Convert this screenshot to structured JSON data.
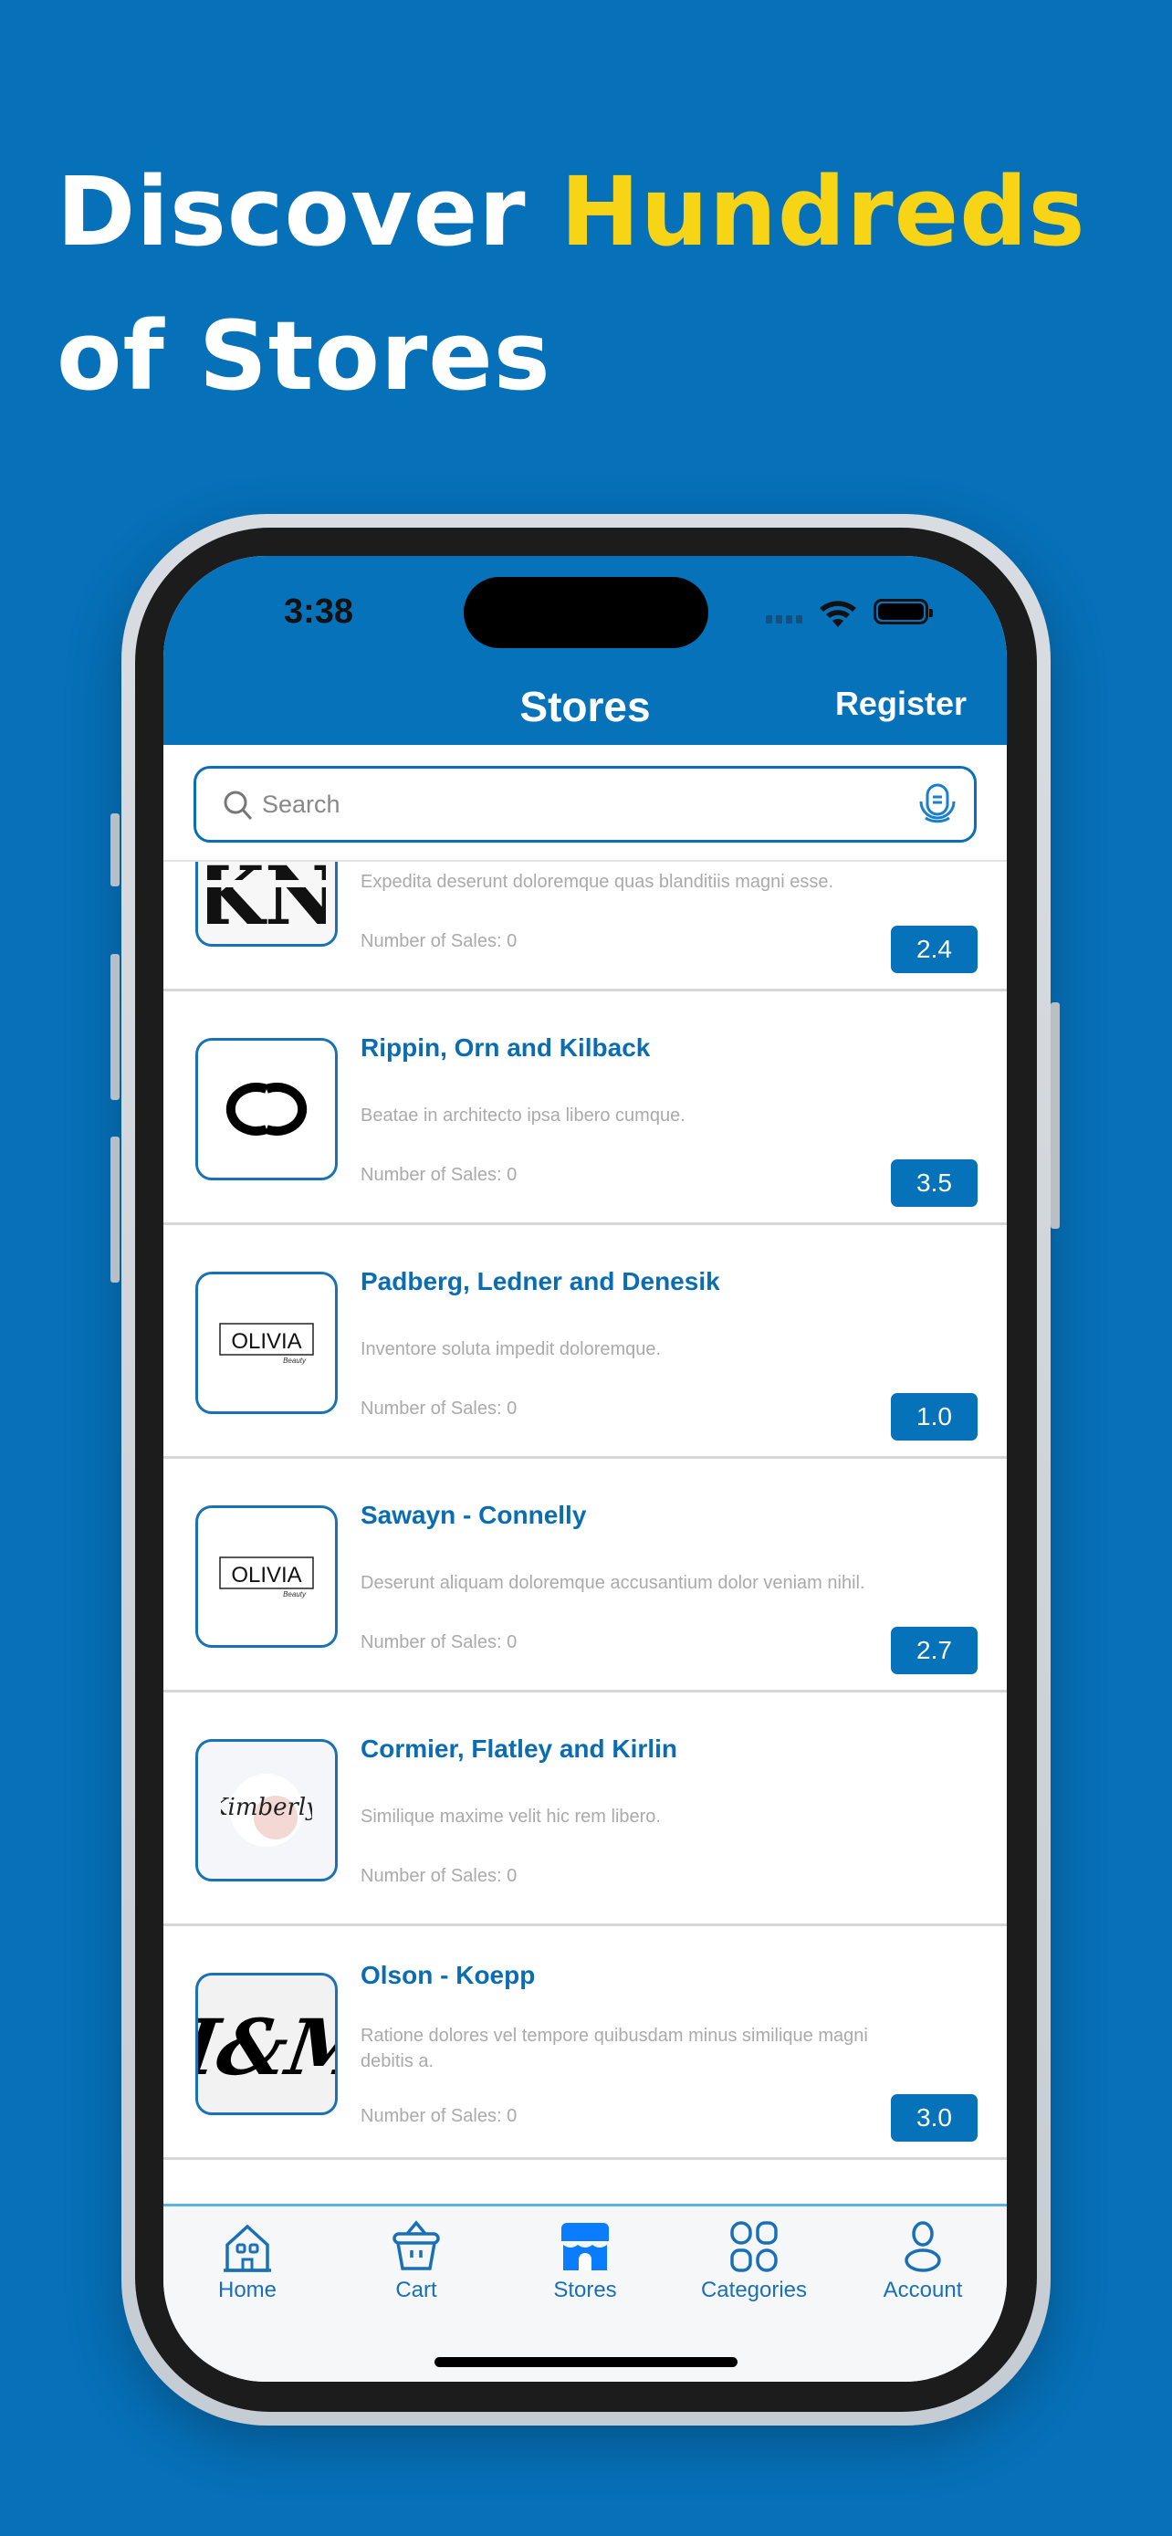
{
  "promo": {
    "line1_prefix": "Discover ",
    "line1_accent": "Hundreds",
    "line2": "of Stores",
    "accent_color": "#f8d417",
    "background_color": "#0670b8"
  },
  "status_bar": {
    "time": "3:38"
  },
  "header": {
    "title": "Stores",
    "register_label": "Register"
  },
  "search": {
    "placeholder": "Search",
    "value": ""
  },
  "stores": [
    {
      "name": "",
      "description": "Expedita deserunt doloremque quas blanditiis magni esse.",
      "sales": "Number of Sales: 0",
      "rating": "2.4",
      "logo": "KN"
    },
    {
      "name": "Rippin, Orn and Kilback",
      "description": "Beatae in architecto ipsa libero cumque.",
      "sales": "Number of Sales: 0",
      "rating": "3.5",
      "logo": "chanel"
    },
    {
      "name": "Padberg, Ledner and Denesik",
      "description": "Inventore soluta impedit doloremque.",
      "sales": "Number of Sales: 0",
      "rating": "1.0",
      "logo": "OLIVIA"
    },
    {
      "name": "Sawayn - Connelly",
      "description": "Deserunt aliquam doloremque accusantium dolor veniam nihil.",
      "sales": "Number of Sales: 0",
      "rating": "2.7",
      "logo": "OLIVIA"
    },
    {
      "name": "Cormier, Flatley and Kirlin",
      "description": "Similique maxime velit hic rem libero.",
      "sales": "Number of Sales: 0",
      "rating": null,
      "logo": "Kimberly"
    },
    {
      "name": "Olson - Koepp",
      "description": "Ratione dolores vel tempore quibusdam minus similique magni debitis a.",
      "sales": "Number of Sales: 0",
      "rating": "3.0",
      "logo": "H&M"
    }
  ],
  "tabs": [
    {
      "label": "Home",
      "icon": "home-icon"
    },
    {
      "label": "Cart",
      "icon": "basket-icon"
    },
    {
      "label": "Stores",
      "icon": "store-icon",
      "active": true
    },
    {
      "label": "Categories",
      "icon": "grid-icon"
    },
    {
      "label": "Account",
      "icon": "person-icon"
    }
  ],
  "colors": {
    "primary": "#0672b9",
    "active_tab": "#0a7cff"
  }
}
